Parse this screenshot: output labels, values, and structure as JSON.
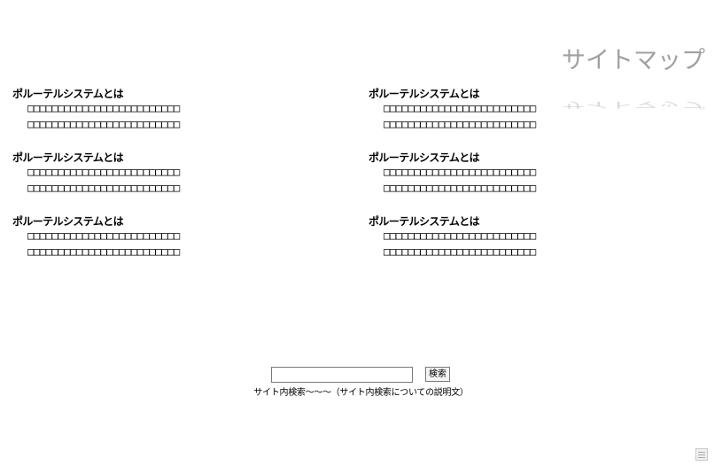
{
  "header": {
    "title": "サイトマップ"
  },
  "sections": [
    {
      "heading": "ポルーテルシステムとは",
      "lines": [
        "□□□□□□□□□□□□□□□□□□□□□□□□□",
        "□□□□□□□□□□□□□□□□□□□□□□□□□"
      ]
    },
    {
      "heading": "ポルーテルシステムとは",
      "lines": [
        "□□□□□□□□□□□□□□□□□□□□□□□□□",
        "□□□□□□□□□□□□□□□□□□□□□□□□□"
      ]
    },
    {
      "heading": "ポルーテルシステムとは",
      "lines": [
        "□□□□□□□□□□□□□□□□□□□□□□□□□",
        "□□□□□□□□□□□□□□□□□□□□□□□□□"
      ]
    },
    {
      "heading": "ポルーテルシステムとは",
      "lines": [
        "□□□□□□□□□□□□□□□□□□□□□□□□□",
        "□□□□□□□□□□□□□□□□□□□□□□□□□"
      ]
    },
    {
      "heading": "ポルーテルシステムとは",
      "lines": [
        "□□□□□□□□□□□□□□□□□□□□□□□□□",
        "□□□□□□□□□□□□□□□□□□□□□□□□□"
      ]
    },
    {
      "heading": "ポルーテルシステムとは",
      "lines": [
        "□□□□□□□□□□□□□□□□□□□□□□□□□",
        "□□□□□□□□□□□□□□□□□□□□□□□□□"
      ]
    }
  ],
  "search": {
    "value": "",
    "button_label": "検索",
    "description": "サイト内検索～～～（サイト内検索についての説明文）"
  },
  "icons": {
    "corner": "document-icon"
  }
}
